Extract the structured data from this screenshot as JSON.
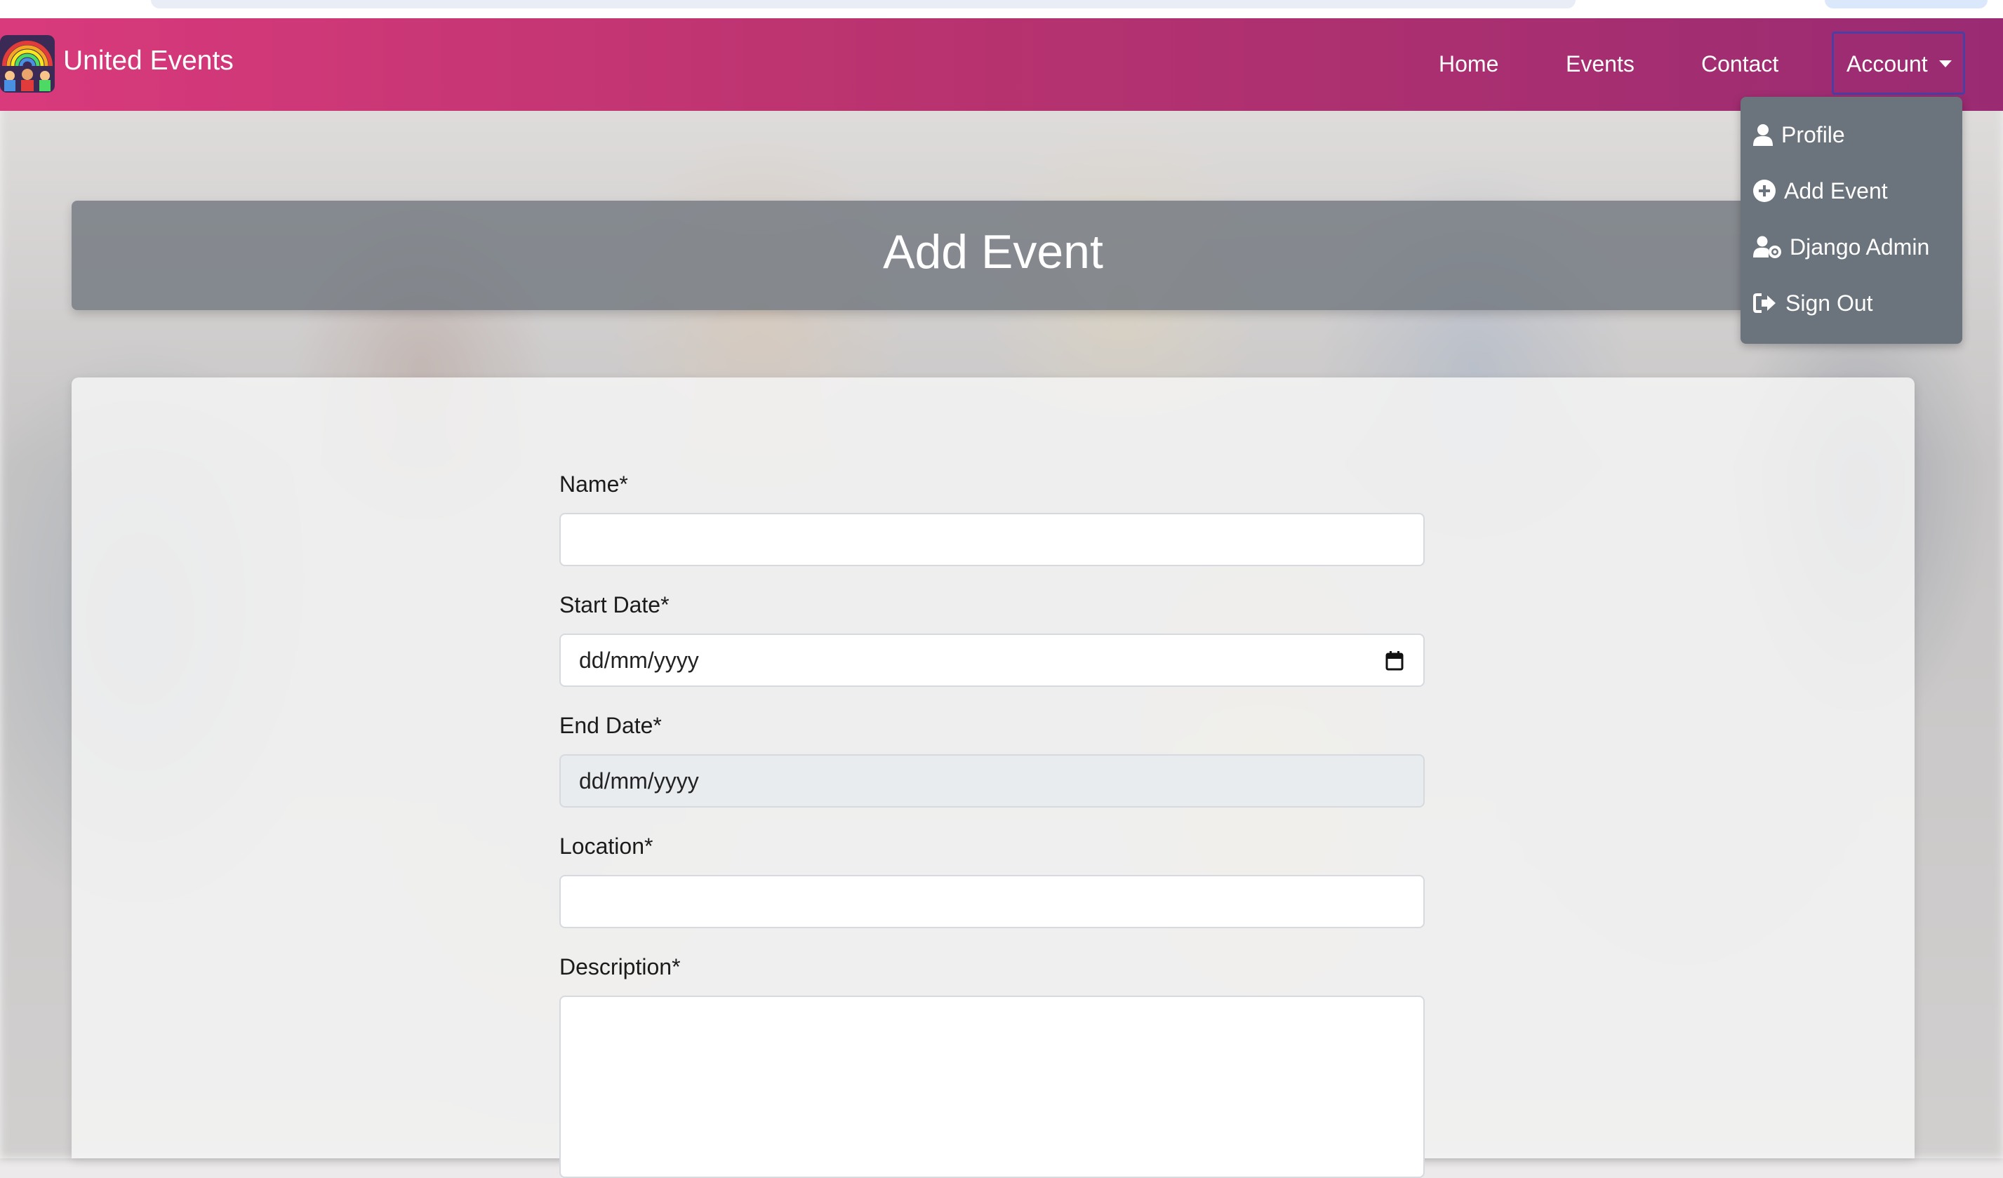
{
  "navbar": {
    "brand": "United Events",
    "links": {
      "home": "Home",
      "events": "Events",
      "contact": "Contact",
      "account": "Account"
    }
  },
  "account_menu": {
    "items": [
      {
        "label": "Profile",
        "icon": "user-icon"
      },
      {
        "label": "Add Event",
        "icon": "plus-circle-icon"
      },
      {
        "label": "Django Admin",
        "icon": "user-gear-icon"
      },
      {
        "label": "Sign Out",
        "icon": "sign-out-icon"
      }
    ]
  },
  "page": {
    "title": "Add Event"
  },
  "form": {
    "name_label": "Name*",
    "name_value": "",
    "start_date_label": "Start Date*",
    "start_date_placeholder": "dd/mm/yyyy",
    "end_date_label": "End Date*",
    "end_date_placeholder": "dd/mm/yyyy",
    "location_label": "Location*",
    "location_value": "",
    "description_label": "Description*",
    "description_value": ""
  },
  "colors": {
    "navbar_start": "#d93a7c",
    "navbar_end": "#9a2b72",
    "dropdown_bg": "#6b737c",
    "banner_bg": "#6e747c",
    "focus_outline": "#4b3fa3"
  }
}
